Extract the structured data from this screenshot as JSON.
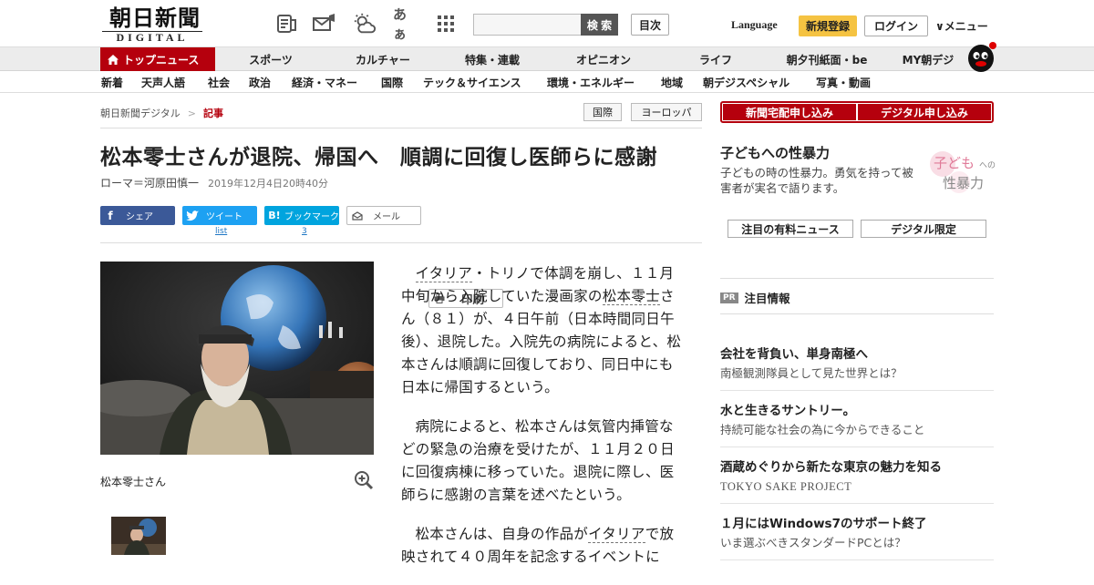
{
  "header": {
    "logo_jp": "朝日新聞",
    "logo_en": "DIGITAL",
    "search_placeholder": "",
    "search_button": "検 索",
    "toc_button": "目次",
    "language": "Language",
    "register": "新規登録",
    "login": "ログイン",
    "menu": "∨メニュー",
    "icons": [
      "newspaper-icon",
      "mail-megaphone-icon",
      "weather-icon",
      "font-size-icon",
      "grid-icon"
    ],
    "font_size_label": "あぁ"
  },
  "nav_primary": {
    "home": "トップニュース",
    "items": [
      "スポーツ",
      "カルチャー",
      "特集・連載",
      "オピニオン",
      "ライフ",
      "朝夕刊紙面・be",
      "MY朝デジ"
    ]
  },
  "nav_secondary": {
    "items": [
      "新着",
      "天声人語",
      "社会",
      "政治",
      "経済・マネー",
      "国際",
      "テック＆サイエンス",
      "環境・エネルギー",
      "地域",
      "朝デジスペシャル",
      "写真・動画"
    ]
  },
  "breadcrumb": {
    "root": "朝日新聞デジタル",
    "sep": ">",
    "current": "記事"
  },
  "tags": [
    "国際",
    "ヨーロッパ"
  ],
  "article": {
    "title": "松本零士さんが退院、帰国へ　順調に回復し医師らに感謝",
    "byline": "ローマ＝河原田慎一",
    "date": "2019年12月4日20時40分",
    "share": {
      "facebook": "シェア",
      "twitter": "ツイート",
      "hatena": "ブックマーク",
      "mail": "メール",
      "print": "印刷",
      "twitter_count": "list",
      "hatena_count": "3"
    },
    "caption": "松本零士さん",
    "p1_a": "イタリア",
    "p1_b": "・トリノで体調を崩し、１１月中旬から入院していた漫画家の",
    "p1_c": "松本零士",
    "p1_d": "さん（８１）が、４日午前（日本時間同日午後）、退院した。入院先の病院によると、松本さんは順調に回復しており、同日中にも日本に帰国するという。",
    "p2": "病院によると、松本さんは気管内挿管などの緊急の治療を受けたが、１１月２０日に回復病棟に移っていた。退院に際し、医師らに感謝の言葉を述べたという。",
    "p3_a": "松本さんは、自身の作品が",
    "p3_b": "イタリア",
    "p3_c": "で放映されて４０周年を記念するイベントに"
  },
  "sidebar": {
    "cta_left": "新聞宅配申し込み",
    "cta_right": "デジタル申し込み",
    "promo_title": "子どもへの性暴力",
    "promo_desc": "子どもの時の性暴力。勇気を持って被害者が実名で語ります。",
    "promo_img_a": "子ども",
    "promo_img_b": "への",
    "promo_img_c": "性暴力",
    "tab_left": "注目の有料ニュース",
    "tab_right": "デジタル限定",
    "pr_badge": "PR",
    "pr_label": "注目情報",
    "ads": [
      {
        "title": "会社を背負い、単身南極へ",
        "sub": "南極観測隊員として見た世界とは？"
      },
      {
        "title": "水と生きるサントリー。",
        "sub": "持続可能な社会の為に今からできること"
      },
      {
        "title": "酒蔵めぐりから新たな東京の魅力を知る",
        "sub": "TOKYO SAKE PROJECT"
      },
      {
        "title": "１月にはWindows7のサポート終了",
        "sub": "いま選ぶべきスタンダードPCとは？"
      }
    ]
  },
  "colors": {
    "brand_red": "#b5000d",
    "register_yellow": "#f5c342",
    "facebook": "#3b5998",
    "twitter": "#1da1f2",
    "hatena": "#00a4de"
  }
}
